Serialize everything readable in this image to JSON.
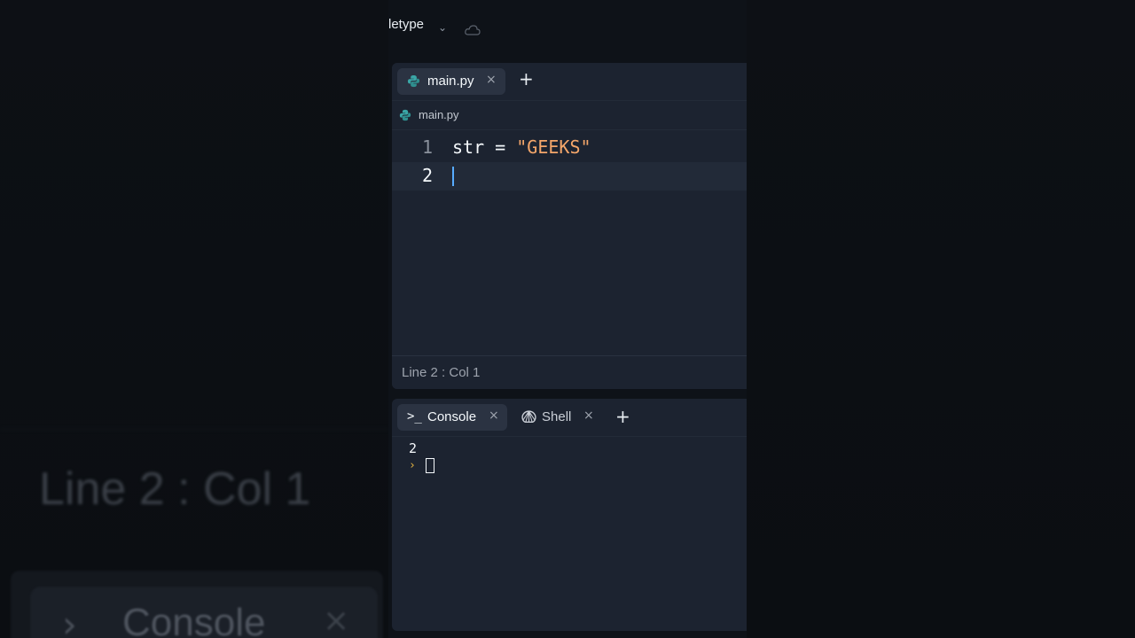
{
  "topbar": {
    "app_name": "letype"
  },
  "editor": {
    "tab": {
      "label": "main.py"
    },
    "breadcrumb": "main.py",
    "lines": [
      {
        "number": "1",
        "tokens": {
          "ident": "str",
          "op": " = ",
          "string": "\"GEEKS\""
        }
      },
      {
        "number": "2"
      }
    ],
    "status": "Line 2 : Col 1"
  },
  "console": {
    "tabs": {
      "console": {
        "icon": ">_",
        "label": "Console"
      },
      "shell": {
        "label": "Shell"
      }
    },
    "output": "2",
    "prompt_symbol": "›"
  },
  "background": {
    "status_echo": "Line 2 : Col 1",
    "console_echo": "Console"
  },
  "icons": {
    "close": "×",
    "add": "+",
    "chevron": "⌄",
    "python": "python-icon",
    "shell": "shell-icon",
    "cloud": "cloud-icon"
  },
  "colors": {
    "panel": "#1c2330",
    "active_tab": "#2b3342",
    "string": "#f4a66a",
    "cursor": "#57abff",
    "python_icon": "#3aa6a6",
    "prompt": "#e3b341"
  }
}
